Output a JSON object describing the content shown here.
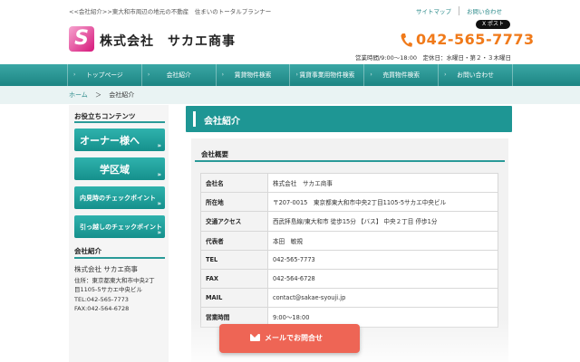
{
  "header": {
    "tagline": "<<会社紹介>>東大和市周辺の地元の不動産　住まいのトータルプランナー",
    "top_links": [
      "サイトマップ",
      "お問い合わせ"
    ],
    "x_post_label": "X ポスト",
    "logo_letter": "S",
    "company_name": "株式会社　サカエ商事",
    "phone_icon": "phone-icon",
    "phone": "042-565-7773",
    "hours": "営業時間/9:00〜18:00　定休日：水曜日・第２・３木曜日"
  },
  "nav": {
    "items": [
      "トップページ",
      "会社紹介",
      "賃貸物件検索",
      "賃貸事業用物件検索",
      "売買物件検索",
      "お問い合わせ"
    ]
  },
  "breadcrumb": {
    "home": "ホーム",
    "separator": "＞",
    "current": "会社紹介"
  },
  "sidebar": {
    "section_title": "お役立ちコンテンツ",
    "buttons": [
      "オーナー様へ",
      "学区域",
      "内見時のチェックポイント",
      "引っ越しのチェックポイント"
    ],
    "arrow": "»",
    "company_title": "会社紹介",
    "company_info": {
      "name": "株式会社 サカエ商事",
      "address_line1": "住所：東京都東大和市中央2丁",
      "address_line2": "目1105-5サカエ中央ビル",
      "tel": "TEL:042-565-7773",
      "fax": "FAX:042-564-6728"
    }
  },
  "main": {
    "heading": "会社紹介",
    "section_title": "会社概要",
    "rows": [
      {
        "key": "会社名",
        "value": "株式会社　サカエ商事"
      },
      {
        "key": "所在地",
        "value": "〒207-0015　東京都東大和市中央2丁目1105-5サカエ中央ビル"
      },
      {
        "key": "交通アクセス",
        "value": "西武拝島線/東大和市 徒歩15分 【バス】 中央２丁目 停歩1分"
      },
      {
        "key": "代表者",
        "value": "本田　敏規"
      },
      {
        "key": "TEL",
        "value": "042-565-7773"
      },
      {
        "key": "FAX",
        "value": "042-564-6728"
      },
      {
        "key": "MAIL",
        "value": "contact@sakae-syouji.jp"
      },
      {
        "key": "営業時間",
        "value": "9:00〜18:00"
      }
    ],
    "mail_button": "メールでお問合せ",
    "mail_icon": "envelope-icon"
  },
  "colors": {
    "accent": "#1e9694",
    "phone": "#f07a1a",
    "mail_button": "#ee6555",
    "logo": "#d6177b"
  }
}
